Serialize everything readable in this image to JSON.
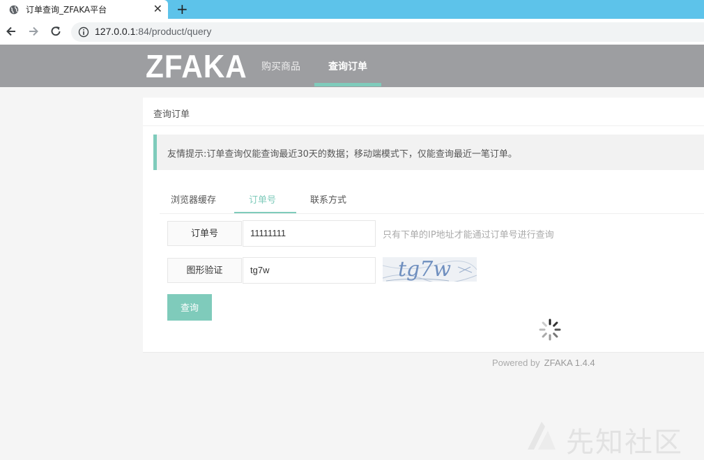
{
  "browser": {
    "tab_title": "订单查询_ZFAKA平台",
    "new_tab_label": "+",
    "tab_close_label": "✕",
    "url_host": "127.0.0.1",
    "url_path": ":84/product/query"
  },
  "header": {
    "logo": "ZFAKA",
    "nav": [
      {
        "label": "购买商品",
        "active": false
      },
      {
        "label": "查询订单",
        "active": true
      }
    ],
    "accent_color": "#7fcbbb"
  },
  "card": {
    "title": "查询订单",
    "notice": "友情提示:订单查询仅能查询最近30天的数据；移动端模式下，仅能查询最近一笔订单。",
    "tabs": [
      {
        "label": "浏览器缓存",
        "active": false
      },
      {
        "label": "订单号",
        "active": true
      },
      {
        "label": "联系方式",
        "active": false
      }
    ],
    "form": {
      "order_label": "订单号",
      "order_value": "11111111",
      "order_hint": "只有下单的IP地址才能通过订单号进行查询",
      "captcha_label": "图形验证",
      "captcha_value": "tg7w",
      "captcha_image_text": "tg7w",
      "submit_label": "查询"
    }
  },
  "footer": {
    "powered_by": "Powered by",
    "brand": "ZFAKA 1.4.4"
  },
  "watermark": {
    "text": "先知社区"
  }
}
